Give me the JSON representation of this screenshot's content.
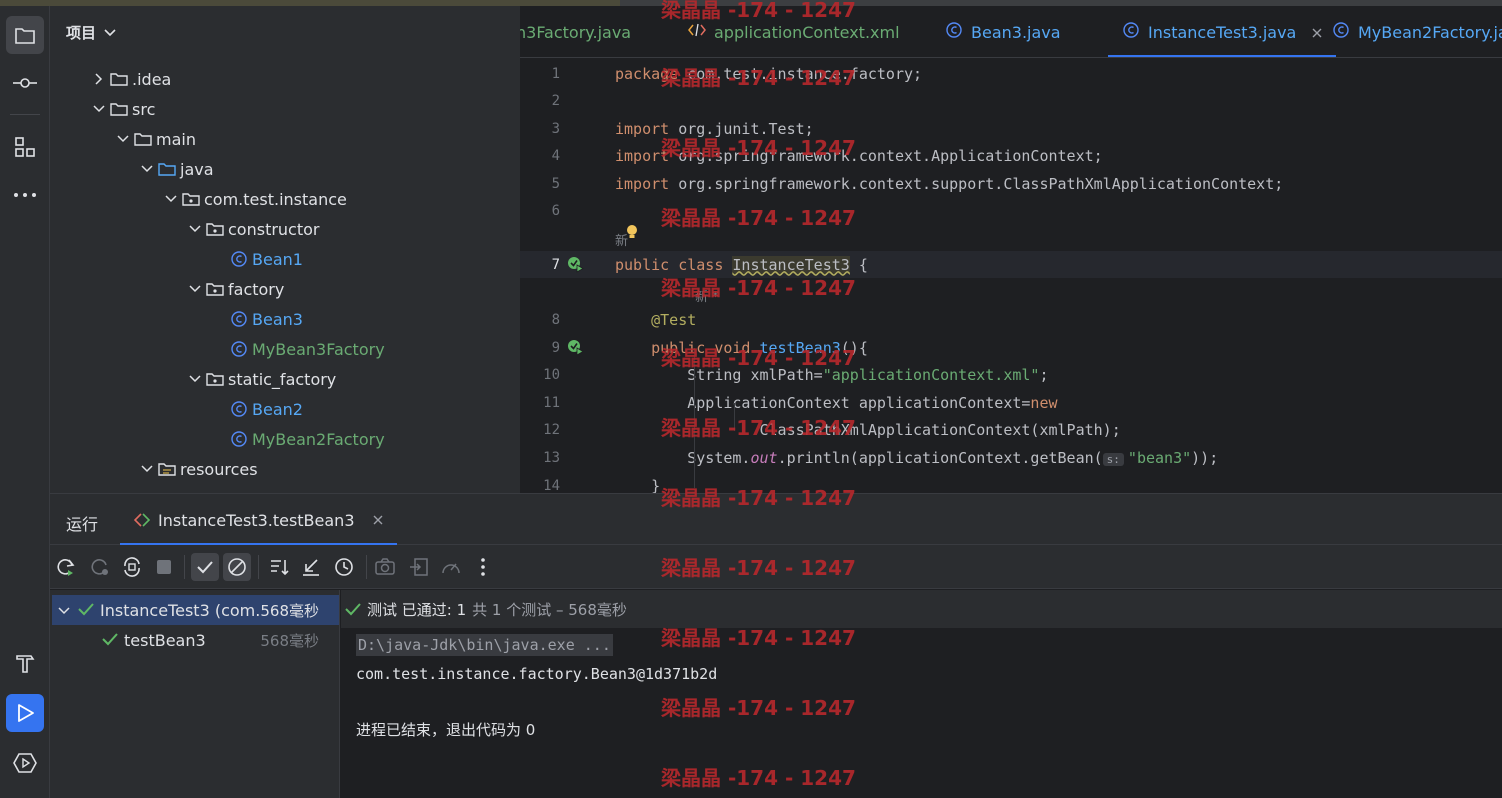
{
  "project_panel": {
    "title": "项目",
    "tree": [
      {
        "label": ".idea",
        "indent": 1,
        "chev": "right",
        "icon": "folder-icon",
        "color": "default"
      },
      {
        "label": "src",
        "indent": 1,
        "chev": "down",
        "icon": "folder-icon",
        "color": "default"
      },
      {
        "label": "main",
        "indent": 2,
        "chev": "down",
        "icon": "folder-icon",
        "color": "default"
      },
      {
        "label": "java",
        "indent": 3,
        "chev": "down",
        "icon": "source-folder-icon",
        "color": "default"
      },
      {
        "label": "com.test.instance",
        "indent": 4,
        "chev": "down",
        "icon": "package-icon",
        "color": "default"
      },
      {
        "label": "constructor",
        "indent": 5,
        "chev": "down",
        "icon": "package-icon",
        "color": "default"
      },
      {
        "label": "Bean1",
        "indent": 6,
        "chev": "none",
        "icon": "class-icon",
        "color": "blue"
      },
      {
        "label": "factory",
        "indent": 5,
        "chev": "down",
        "icon": "package-icon",
        "color": "default"
      },
      {
        "label": "Bean3",
        "indent": 6,
        "chev": "none",
        "icon": "class-icon",
        "color": "blue"
      },
      {
        "label": "MyBean3Factory",
        "indent": 6,
        "chev": "none",
        "icon": "class-icon",
        "color": "green"
      },
      {
        "label": "static_factory",
        "indent": 5,
        "chev": "down",
        "icon": "package-icon",
        "color": "default"
      },
      {
        "label": "Bean2",
        "indent": 6,
        "chev": "none",
        "icon": "class-icon",
        "color": "blue"
      },
      {
        "label": "MyBean2Factory",
        "indent": 6,
        "chev": "none",
        "icon": "class-icon",
        "color": "green"
      },
      {
        "label": "resources",
        "indent": 3,
        "chev": "down",
        "icon": "resources-folder-icon",
        "color": "default"
      }
    ]
  },
  "editor": {
    "tabs": [
      {
        "label": "n3Factory.java",
        "icon": "class-icon",
        "active": false
      },
      {
        "label": "applicationContext.xml",
        "icon": "xml-icon",
        "active": false
      },
      {
        "label": "Bean3.java",
        "icon": "class-icon",
        "active": false
      },
      {
        "label": "InstanceTest3.java",
        "icon": "class-icon",
        "active": true
      },
      {
        "label": "MyBean2Factory.ja",
        "icon": "class-icon",
        "active": false
      }
    ],
    "line_numbers": [
      "1",
      "2",
      "3",
      "4",
      "5",
      "6",
      "7",
      "8",
      "9",
      "10",
      "11",
      "12",
      "13",
      "14"
    ],
    "lines": [
      {
        "n": "1",
        "text": "package com.test.instance.factory;"
      },
      {
        "n": "2",
        "text": ""
      },
      {
        "n": "3",
        "text": "import org.junit.Test;"
      },
      {
        "n": "4",
        "text": "import org.springframework.context.ApplicationContext;"
      },
      {
        "n": "5",
        "text": "import org.springframework.context.support.ClassPathXmlApplicationContext;"
      },
      {
        "n": "6",
        "text": ""
      },
      {
        "n": "7",
        "text": "public class InstanceTest3 {"
      },
      {
        "n": "8",
        "text": "    @Test"
      },
      {
        "n": "9",
        "text": "    public void testBean3(){"
      },
      {
        "n": "10",
        "text": "        String xmlPath=\"applicationContext.xml\";"
      },
      {
        "n": "11",
        "text": "        ApplicationContext applicationContext=new"
      },
      {
        "n": "12",
        "text": "                ClassPathXmlApplicationContext(xmlPath);"
      },
      {
        "n": "13",
        "text": "        System.out.println(applicationContext.getBean(\"bean3\"));"
      },
      {
        "n": "14",
        "text": "    }"
      }
    ],
    "inlay_new_1": "新",
    "inlay_new_2": "新 *",
    "param_hint": "s:"
  },
  "run_panel": {
    "title": "运行",
    "tab_label": "InstanceTest3.testBean3",
    "status_pass": "测试 已通过: 1",
    "status_detail": "共 1 个测试 – 568毫秒",
    "tree": [
      {
        "label": "InstanceTest3 (com.",
        "time": "568毫秒",
        "selected": true
      },
      {
        "label": "testBean3",
        "time": "568毫秒",
        "selected": false
      }
    ],
    "console": {
      "cmd": "D:\\java-Jdk\\bin\\java.exe ...",
      "output": "com.test.instance.factory.Bean3@1d371b2d",
      "exit": "进程已结束，退出代码为 0"
    }
  },
  "watermark": "梁晶晶 -174 - 1247",
  "colors": {
    "accent": "#3574f0",
    "pass": "#5fb865",
    "watermark": "#b8282c"
  }
}
